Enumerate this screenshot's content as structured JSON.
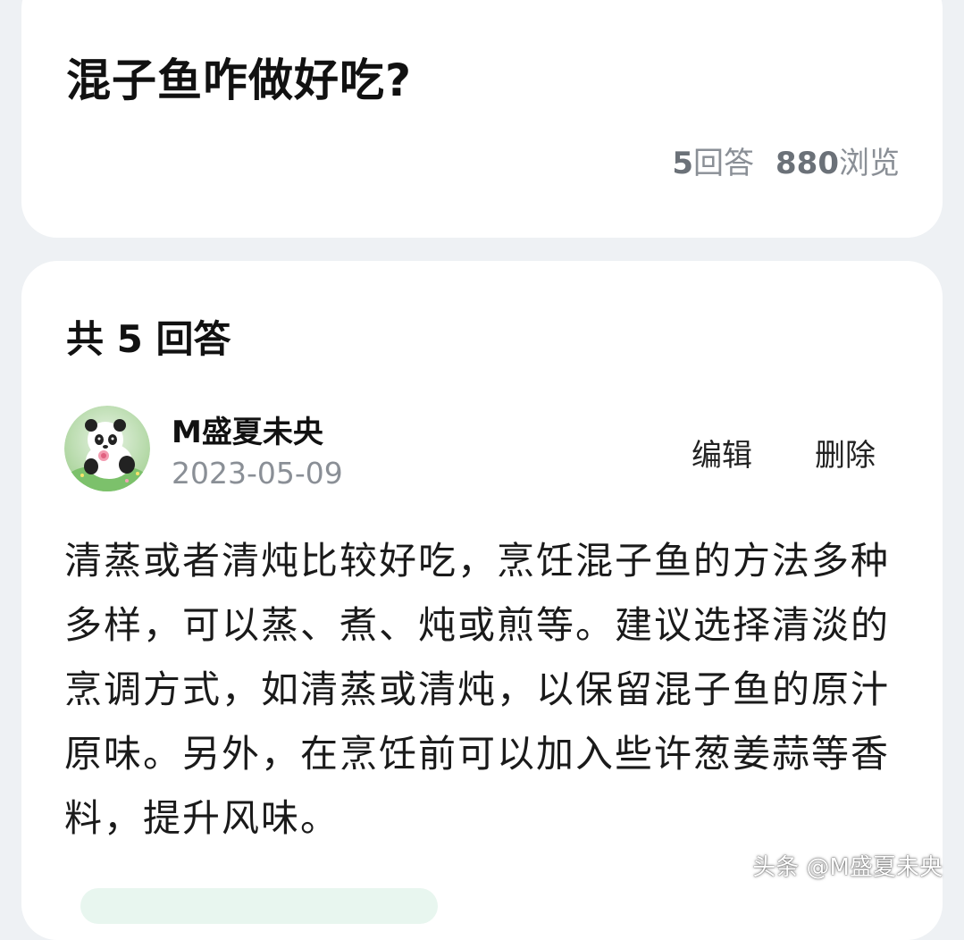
{
  "question": {
    "title": "混子鱼咋做好吃?",
    "answer_count": "5",
    "answer_count_suffix": "回答",
    "view_count": "880",
    "view_count_suffix": "浏览"
  },
  "answers": {
    "heading": "共 5 回答",
    "items": [
      {
        "author": "M盛夏未央",
        "date": "2023-05-09",
        "edit_label": "编辑",
        "delete_label": "删除",
        "text": "清蒸或者清炖比较好吃，烹饪混子鱼的方法多种多样，可以蒸、煮、炖或煎等。建议选择清淡的烹调方式，如清蒸或清炖，以保留混子鱼的原汁原味。另外，在烹饪前可以加入些许葱姜蒜等香料，提升风味。"
      }
    ]
  },
  "watermark": "头条 @M盛夏未央",
  "icons": {
    "avatar": "panda-avatar-icon"
  }
}
